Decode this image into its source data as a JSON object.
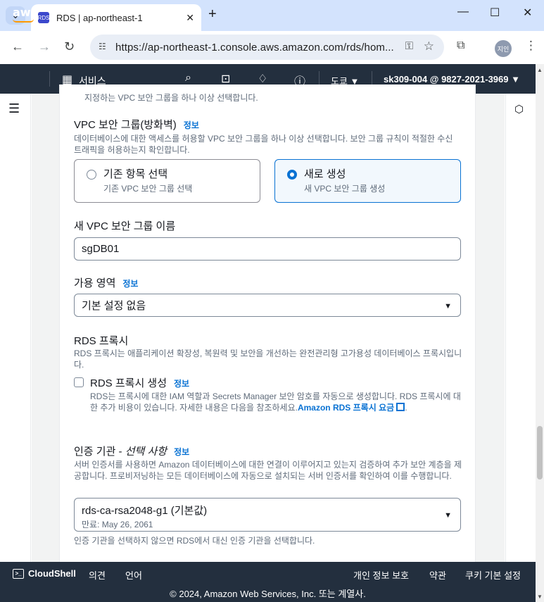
{
  "browser": {
    "tab_title": "RDS | ap-northeast-1",
    "favicon_text": "RDS",
    "url": "https://ap-northeast-1.console.aws.amazon.com/rds/hom...",
    "profile_label": "지인",
    "icons": [
      "tab-list-icon",
      "close-icon",
      "plus-icon",
      "minimize-icon",
      "maximize-icon",
      "window-close-icon",
      "back-icon",
      "forward-icon",
      "reload-icon",
      "site-info-icon",
      "key-icon",
      "star-icon",
      "extensions-icon",
      "kebab-menu-icon"
    ]
  },
  "aws_nav": {
    "logo": "aws",
    "services_label": "서비스",
    "region_label": "도쿄 ▼",
    "account_label": "sk309-004 @ 9827-2021-3969 ▼"
  },
  "content": {
    "cut_off_text": "지정하는 VPC 보안 그룹을 하나 이상 선택합니다.",
    "vpc_sg": {
      "label": "VPC 보안 그룹(방화벽)",
      "info": "정보",
      "description": "데이터베이스에 대한 액세스를 허용할 VPC 보안 그룹을 하나 이상 선택합니다. 보안 그룹 규칙이 적절한 수신 트래픽을 허용하는지 확인합니다.",
      "options": [
        {
          "title": "기존 항목 선택",
          "subtitle": "기존 VPC 보안 그룹 선택",
          "selected": false
        },
        {
          "title": "새로 생성",
          "subtitle": "새 VPC 보안 그룹 생성",
          "selected": true
        }
      ]
    },
    "new_sg_name": {
      "label": "새 VPC 보안 그룹 이름",
      "value": "sgDB01"
    },
    "az": {
      "label": "가용 영역",
      "info": "정보",
      "value": "기본 설정 없음"
    },
    "rds_proxy": {
      "heading": "RDS 프록시",
      "description": "RDS 프록시는 애플리케이션 확장성, 복원력 및 보안을 개선하는 완전관리형 고가용성 데이터베이스 프록시입니다.",
      "checkbox_label": "RDS 프록시 생성",
      "checkbox_checked": false,
      "info": "정보",
      "checkbox_help": "RDS는 프록시에 대한 IAM 역할과 Secrets Manager 보안 암호를 자동으로 생성합니다. RDS 프록시에 대한 추가 비용이 있습니다. 자세한 내용은 다음을 참조하세요.",
      "link_text": "Amazon RDS 프록시 요금",
      "link_suffix": "."
    },
    "ca": {
      "label_main": "인증 기관 - ",
      "label_optional": "선택 사항",
      "info": "정보",
      "description": "서버 인증서를 사용하면 Amazon 데이터베이스에 대한 연결이 이루어지고 있는지 검증하여 추가 보안 계층을 제공합니다. 프로비저닝하는 모든 데이터베이스에 자동으로 설치되는 서버 인증서를 확인하여 이를 수행합니다.",
      "value": "rds-ca-rsa2048-g1 (기본값)",
      "expiry": "만료: May 26, 2061",
      "hint": "인증 기관을 선택하지 않으면 RDS에서 대신 인증 기관을 선택합니다."
    }
  },
  "footer": {
    "cloudshell": "CloudShell",
    "feedback": "의견",
    "language": "언어",
    "privacy": "개인 정보 보호",
    "terms": "약관",
    "cookies": "쿠키 기본 설정",
    "copyright": "© 2024, Amazon Web Services, Inc. 또는 계열사."
  }
}
